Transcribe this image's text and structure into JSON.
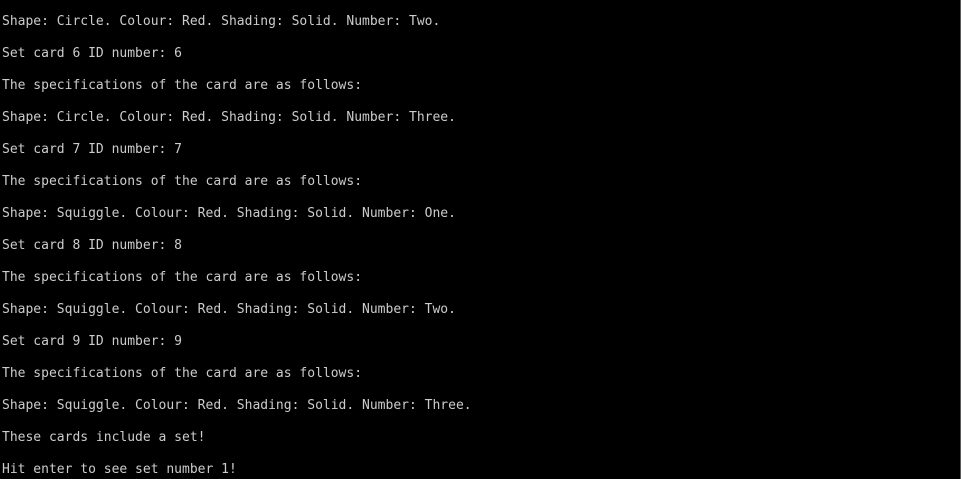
{
  "console": {
    "lines": [
      "Shape: Circle. Colour: Red. Shading: Solid. Number: Two.",
      "Set card 6 ID number: 6",
      "The specifications of the card are as follows:",
      "Shape: Circle. Colour: Red. Shading: Solid. Number: Three.",
      "Set card 7 ID number: 7",
      "The specifications of the card are as follows:",
      "Shape: Squiggle. Colour: Red. Shading: Solid. Number: One.",
      "Set card 8 ID number: 8",
      "The specifications of the card are as follows:",
      "Shape: Squiggle. Colour: Red. Shading: Solid. Number: Two.",
      "Set card 9 ID number: 9",
      "The specifications of the card are as follows:",
      "Shape: Squiggle. Colour: Red. Shading: Solid. Number: Three.",
      "These cards include a set!",
      "Hit enter to see set number 1!"
    ],
    "colors": {
      "background": "#000000",
      "text": "#cccccc"
    }
  }
}
